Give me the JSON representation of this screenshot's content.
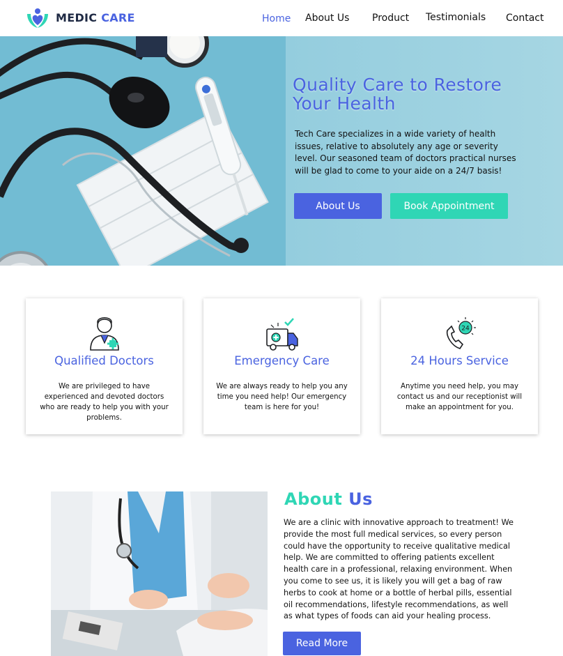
{
  "brand": {
    "name_part1": "MEDIC",
    "name_part2": "CARE",
    "logo_icon": "heart-hands-icon"
  },
  "nav": {
    "items": [
      {
        "label": "Home",
        "active": true
      },
      {
        "label": "About Us",
        "active": false
      },
      {
        "label": "Product",
        "active": false
      },
      {
        "label": "Testimonials",
        "active": false
      },
      {
        "label": "Contact",
        "active": false
      }
    ]
  },
  "hero": {
    "title": "Quality Care to Restore Your Health",
    "description": "Tech Care specializes in a wide variety of health issues, relative to absolutely any age or severity level. Our seasoned team of doctors practical nurses will be glad to come to your aide on a 24/7 basis!",
    "primary_button": "About Us",
    "secondary_button": "Book Appointment"
  },
  "services": [
    {
      "icon": "doctor-icon",
      "title": "Qualified Doctors",
      "text": "We are privileged to have experienced and devoted doctors who are ready to help you with your problems."
    },
    {
      "icon": "ambulance-icon",
      "title": "Emergency Care",
      "text": "We are always ready to help you any time you need help! Our  emergency team is here for you!"
    },
    {
      "icon": "phone-24-icon",
      "title": "24 Hours Service",
      "text": "Anytime you need help, you may contact us and our receptionist will make an appointment for you.",
      "badge": "24"
    }
  ],
  "about": {
    "title_part1": "About",
    "title_part2": "Us",
    "text": "We are a clinic with innovative approach to treatment! We provide the most full medical services, so every person could have the opportunity to receive qualitative medical help. We are committed to offering patients excellent health care in a professional, relaxing environment. When you come to see us, it is likely you will get a bag of raw herbs to cook at home or a bottle of herbal pills, essential oil recommendations, lifestyle recommendations, as well as what types of foods can aid your healing process.",
    "button": "Read More"
  },
  "colors": {
    "primary": "#4a63e0",
    "accent": "#2fd6b5",
    "hero_bg": "#90cbdd"
  }
}
